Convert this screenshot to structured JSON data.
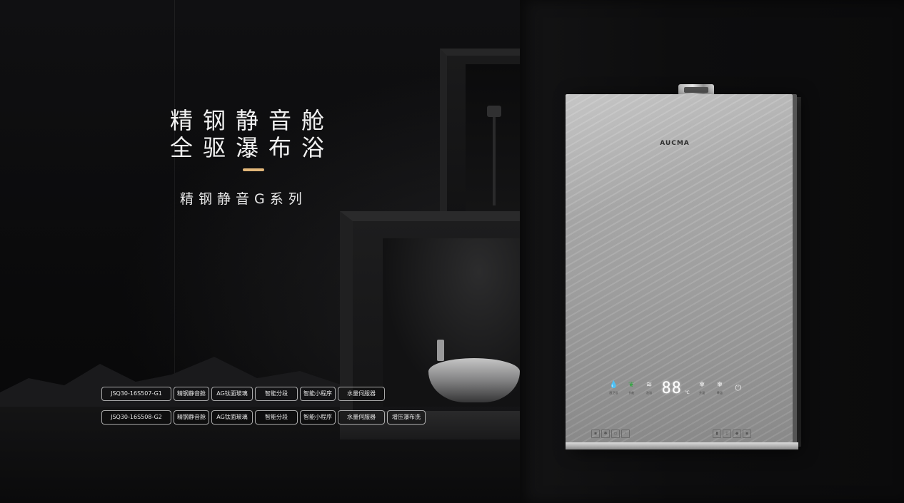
{
  "headline": {
    "line1": "精钢静音舱",
    "line2": "全驱瀑布浴"
  },
  "series_name": "精钢静音G系列",
  "models": [
    {
      "model": "JSQ30-16S507-G1",
      "features": [
        "精钢静音舱",
        "AG钛面玻璃",
        "智能分段",
        "智能小程序",
        "水量伺服器"
      ]
    },
    {
      "model": "JSQ30-16S508-G2",
      "features": [
        "精钢静音舱",
        "AG钛面玻璃",
        "智能分段",
        "智能小程序",
        "水量伺服器",
        "增压瀑布洗"
      ]
    }
  ],
  "product": {
    "brand": "AUCMA",
    "display_value": "88",
    "display_unit": "℃",
    "panel_buttons": [
      {
        "icon": "water-drop-icon",
        "label": "厨卫浴"
      },
      {
        "icon": "leaf-icon",
        "label": "节能"
      },
      {
        "icon": "wave-icon",
        "label": "洗浴"
      }
    ],
    "right_buttons": [
      {
        "icon": "snowflake-icon",
        "label": "升温"
      },
      {
        "icon": "snowflake-icon",
        "label": "降温"
      }
    ],
    "power_icon": "power-icon"
  },
  "colors": {
    "accent": "#e2b77a",
    "background": "#0b0b0c",
    "text": "#f2f2f2"
  }
}
